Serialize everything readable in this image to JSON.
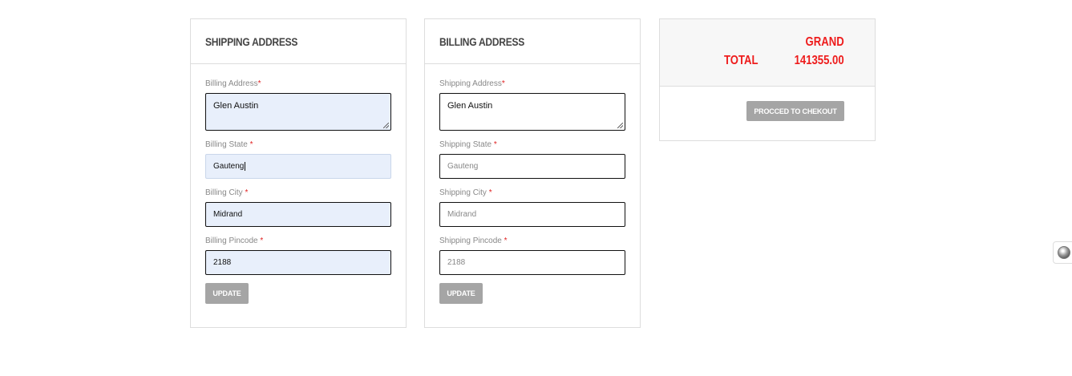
{
  "shipping_panel": {
    "title": "SHIPPING ADDRESS",
    "address_label": "Billing Address",
    "address_value": "Glen Austin",
    "state_label": "Billing State ",
    "state_value": "Gauteng",
    "city_label": "Billing City ",
    "city_value": "Midrand",
    "pincode_label": "Billing Pincode ",
    "pincode_value": "2188",
    "update_label": "UPDATE"
  },
  "billing_panel": {
    "title": "BILLING ADDRESS",
    "address_label": "Shipping Address",
    "address_value": "Glen Austin",
    "state_label": "Shipping State ",
    "state_placeholder": "Gauteng",
    "city_label": "Shipping City ",
    "city_placeholder": "Midrand",
    "pincode_label": "Shipping Pincode ",
    "pincode_placeholder": "2188",
    "update_label": "UPDATE"
  },
  "total_panel": {
    "grand_label": "GRAND",
    "total_label": "TOTAL",
    "total_value": "141355.00",
    "checkout_label": "PROCCED TO CHEKOUT"
  },
  "required_marker": "*",
  "colors": {
    "accent_red": "#ee1c1c",
    "button_gray": "#a5a5a5",
    "filled_input_bg": "#e8effb"
  },
  "icons": {
    "side_widget": "circle-dot-icon"
  }
}
